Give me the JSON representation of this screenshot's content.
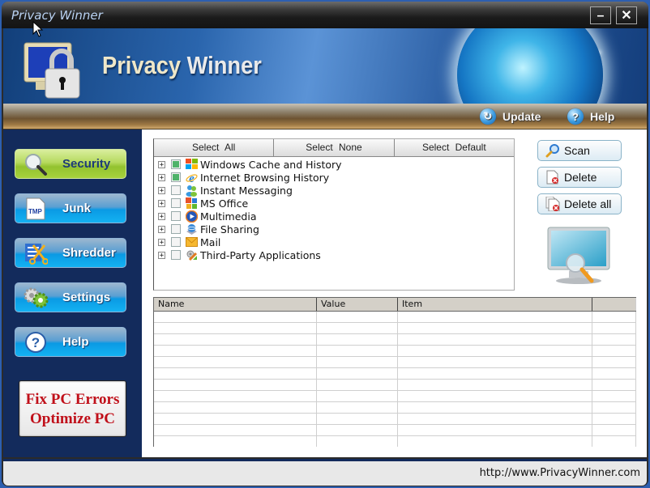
{
  "window": {
    "title": "Privacy Winner",
    "minimize_label": "–",
    "close_label": "✕"
  },
  "banner": {
    "brand_part1": "Privacy",
    "brand_part2": "Winner",
    "logo_icon": "monitor-padlock-icon"
  },
  "toolbar": {
    "update_label": "Update",
    "update_icon": "refresh-icon",
    "help_label": "Help",
    "help_icon": "question-icon"
  },
  "sidebar": {
    "items": [
      {
        "label": "Security",
        "icon": "magnifier-icon",
        "active": true
      },
      {
        "label": "Junk",
        "icon": "tmp-file-icon",
        "active": false
      },
      {
        "label": "Shredder",
        "icon": "scissors-document-icon",
        "active": false
      },
      {
        "label": "Settings",
        "icon": "gears-icon",
        "active": false
      },
      {
        "label": "Help",
        "icon": "question-icon",
        "active": false
      }
    ],
    "promo": {
      "line1": "Fix PC Errors",
      "line2": "Optimize PC"
    }
  },
  "selection": {
    "select_all": "Select All",
    "select_none": "Select None",
    "select_default": "Select Default"
  },
  "categories": [
    {
      "label": "Windows Cache and History",
      "checked": true,
      "icon": "windows-logo-icon"
    },
    {
      "label": "Internet Browsing History",
      "checked": true,
      "icon": "internet-explorer-icon"
    },
    {
      "label": "Instant Messaging",
      "checked": false,
      "icon": "messenger-icon"
    },
    {
      "label": "MS Office",
      "checked": false,
      "icon": "ms-office-icon"
    },
    {
      "label": "Multimedia",
      "checked": false,
      "icon": "media-player-icon"
    },
    {
      "label": "File Sharing",
      "checked": false,
      "icon": "file-sharing-globe-icon"
    },
    {
      "label": "Mail",
      "checked": false,
      "icon": "envelope-icon"
    },
    {
      "label": "Third-Party Applications",
      "checked": false,
      "icon": "applications-icon"
    }
  ],
  "actions": {
    "scan_label": "Scan",
    "delete_label": "Delete",
    "delete_all_label": "Delete all"
  },
  "results": {
    "columns": [
      "Name",
      "Value",
      "Item",
      ""
    ],
    "rows": []
  },
  "status": {
    "url": "http://www.PrivacyWinner.com"
  }
}
